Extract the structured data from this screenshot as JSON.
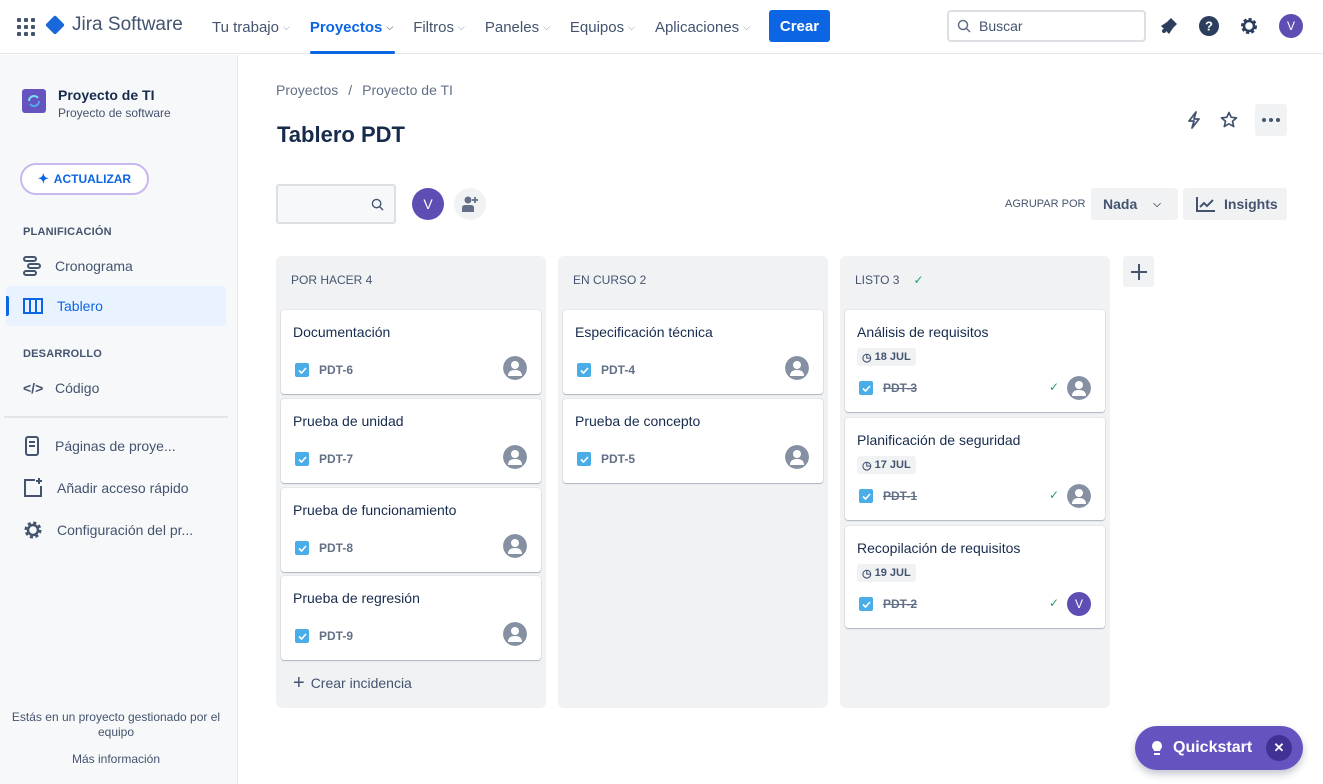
{
  "topbar": {
    "product": "Jira Software",
    "nav": [
      {
        "label": "Tu trabajo",
        "active": false
      },
      {
        "label": "Proyectos",
        "active": true
      },
      {
        "label": "Filtros",
        "active": false
      },
      {
        "label": "Paneles",
        "active": false
      },
      {
        "label": "Equipos",
        "active": false
      },
      {
        "label": "Aplicaciones",
        "active": false
      }
    ],
    "create_label": "Crear",
    "search_placeholder": "Buscar",
    "user_initial": "V",
    "brand_color": "#0c66e4"
  },
  "sidebar": {
    "project_name": "Proyecto de TI",
    "project_type": "Proyecto de software",
    "upgrade_label": "ACTUALIZAR",
    "section_planning": "PLANIFICACIÓN",
    "section_dev": "DESARROLLO",
    "items": [
      {
        "label": "Cronograma",
        "icon": "timeline-icon"
      },
      {
        "label": "Tablero",
        "icon": "board-icon",
        "active": true
      },
      {
        "label": "Código",
        "icon": "code-icon"
      },
      {
        "label": "Páginas de proye...",
        "icon": "page-icon"
      },
      {
        "label": "Añadir acceso rápido",
        "icon": "add-shortcut-icon"
      },
      {
        "label": "Configuración del pr...",
        "icon": "gear-icon"
      }
    ],
    "footer_text": "Estás en un proyecto gestionado por el equipo",
    "footer_link": "Más información"
  },
  "main": {
    "breadcrumb": [
      "Proyectos",
      "Proyecto de TI"
    ],
    "title": "Tablero PDT",
    "member_initial": "V",
    "group_by_label": "AGRUPAR POR",
    "group_by_value": "Nada",
    "insights_label": "Insights",
    "create_issue_label": "Crear incidencia",
    "columns": [
      {
        "title": "POR HACER 4",
        "done": false,
        "cards": [
          {
            "title": "Documentación",
            "key": "PDT-6"
          },
          {
            "title": "Prueba de unidad",
            "key": "PDT-7"
          },
          {
            "title": "Prueba de funcionamiento",
            "key": "PDT-8"
          },
          {
            "title": "Prueba de regresión",
            "key": "PDT-9"
          }
        ]
      },
      {
        "title": "EN CURSO 2",
        "done": false,
        "cards": [
          {
            "title": "Especificación técnica",
            "key": "PDT-4"
          },
          {
            "title": "Prueba de concepto",
            "key": "PDT-5"
          }
        ]
      },
      {
        "title": "LISTO 3",
        "done": true,
        "cards": [
          {
            "title": "Análisis de requisitos",
            "key": "PDT-3",
            "date": "18 JUL"
          },
          {
            "title": "Planificación de seguridad",
            "key": "PDT-1",
            "date": "17 JUL"
          },
          {
            "title": "Recopilación de requisitos",
            "key": "PDT-2",
            "date": "19 JUL",
            "assignee": "V"
          }
        ]
      }
    ]
  },
  "quickstart": {
    "label": "Quickstart"
  }
}
